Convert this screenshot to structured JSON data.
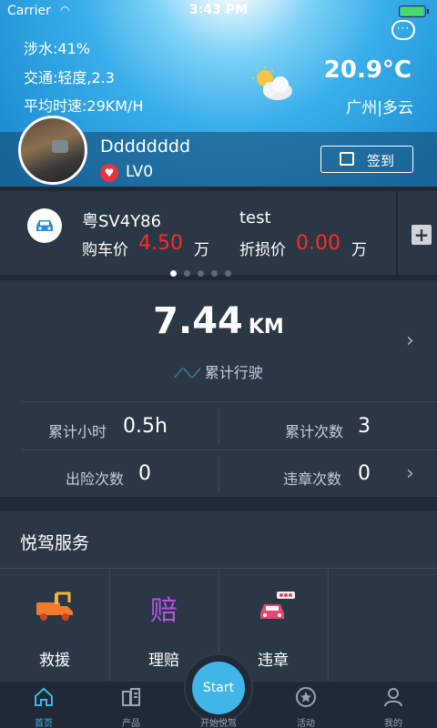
{
  "status": {
    "carrier": "Carrier",
    "time": "3:43 PM"
  },
  "weather": {
    "water": "涉水:41%",
    "traffic": "交通:轻度,2.3",
    "avg_speed": "平均时速:29KM/H",
    "temp": "20.9°C",
    "city": "广州|多云"
  },
  "user": {
    "name": "Dddddddd",
    "level": "LV0",
    "checkin_label": "签到"
  },
  "car": {
    "plate": "粤SV4Y86",
    "name": "test",
    "buy_label": "购车价",
    "buy_value": "4.50",
    "unit": "万",
    "depr_label": "折损价",
    "depr_value": "0.00",
    "page_count": 5,
    "page_active": 0
  },
  "stats": {
    "distance": "7.44",
    "distance_unit": "KM",
    "distance_label": "累计行驶",
    "hours_label": "累计小时",
    "hours_value": "0.5h",
    "trips_label": "累计次数",
    "trips_value": "3",
    "claims_label": "出险次数",
    "claims_value": "0",
    "violations_label": "违章次数",
    "violations_value": "0"
  },
  "services": {
    "title": "悦驾服务",
    "items": [
      {
        "label": "救援",
        "icon": "tow-truck-icon",
        "color": "#f07a2c"
      },
      {
        "label": "理赔",
        "icon": "claim-icon",
        "glyph": "赔",
        "color": "#b453e3"
      },
      {
        "label": "违章",
        "icon": "traffic-light-car-icon",
        "color": "#e8456a"
      }
    ]
  },
  "tabbar": {
    "home": "首页",
    "products": "产品",
    "start_button": "Start",
    "start_label": "开始悦驾",
    "activity": "活动",
    "mine": "我的"
  },
  "colors": {
    "accent": "#3fb5e8",
    "price": "#ff2a2a",
    "panel": "#2a3744",
    "bg": "#1f2a36"
  }
}
